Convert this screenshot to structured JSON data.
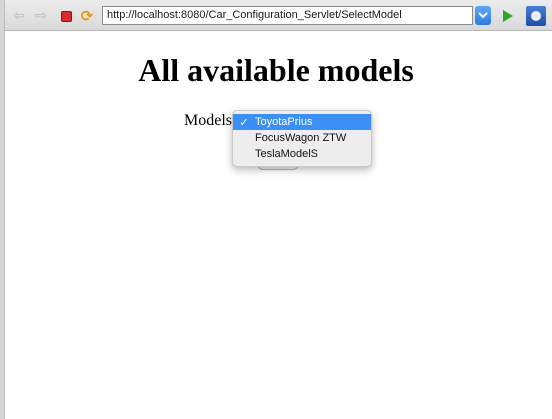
{
  "browser": {
    "url": "http://localhost:8080/Car_Configuration_Servlet/SelectModel",
    "icons": {
      "back": "back-arrow-icon",
      "forward": "forward-arrow-icon",
      "stop": "stop-icon",
      "refresh": "refresh-icon",
      "url_dropdown": "chevron-down-icon",
      "go": "go-arrow-icon",
      "extension": "eclipse-icon"
    }
  },
  "page": {
    "title": "All available models",
    "models_label": "Models",
    "models_select": {
      "selected": "ToyotaPrius",
      "options": [
        {
          "label": "ToyotaPrius",
          "checked": true
        },
        {
          "label": "FocusWagon ZTW",
          "checked": false
        },
        {
          "label": "TeslaModelS",
          "checked": false
        }
      ]
    }
  },
  "colors": {
    "selection": "#3d8ff8",
    "stop": "#d92b2b",
    "go": "#2ea52e"
  }
}
